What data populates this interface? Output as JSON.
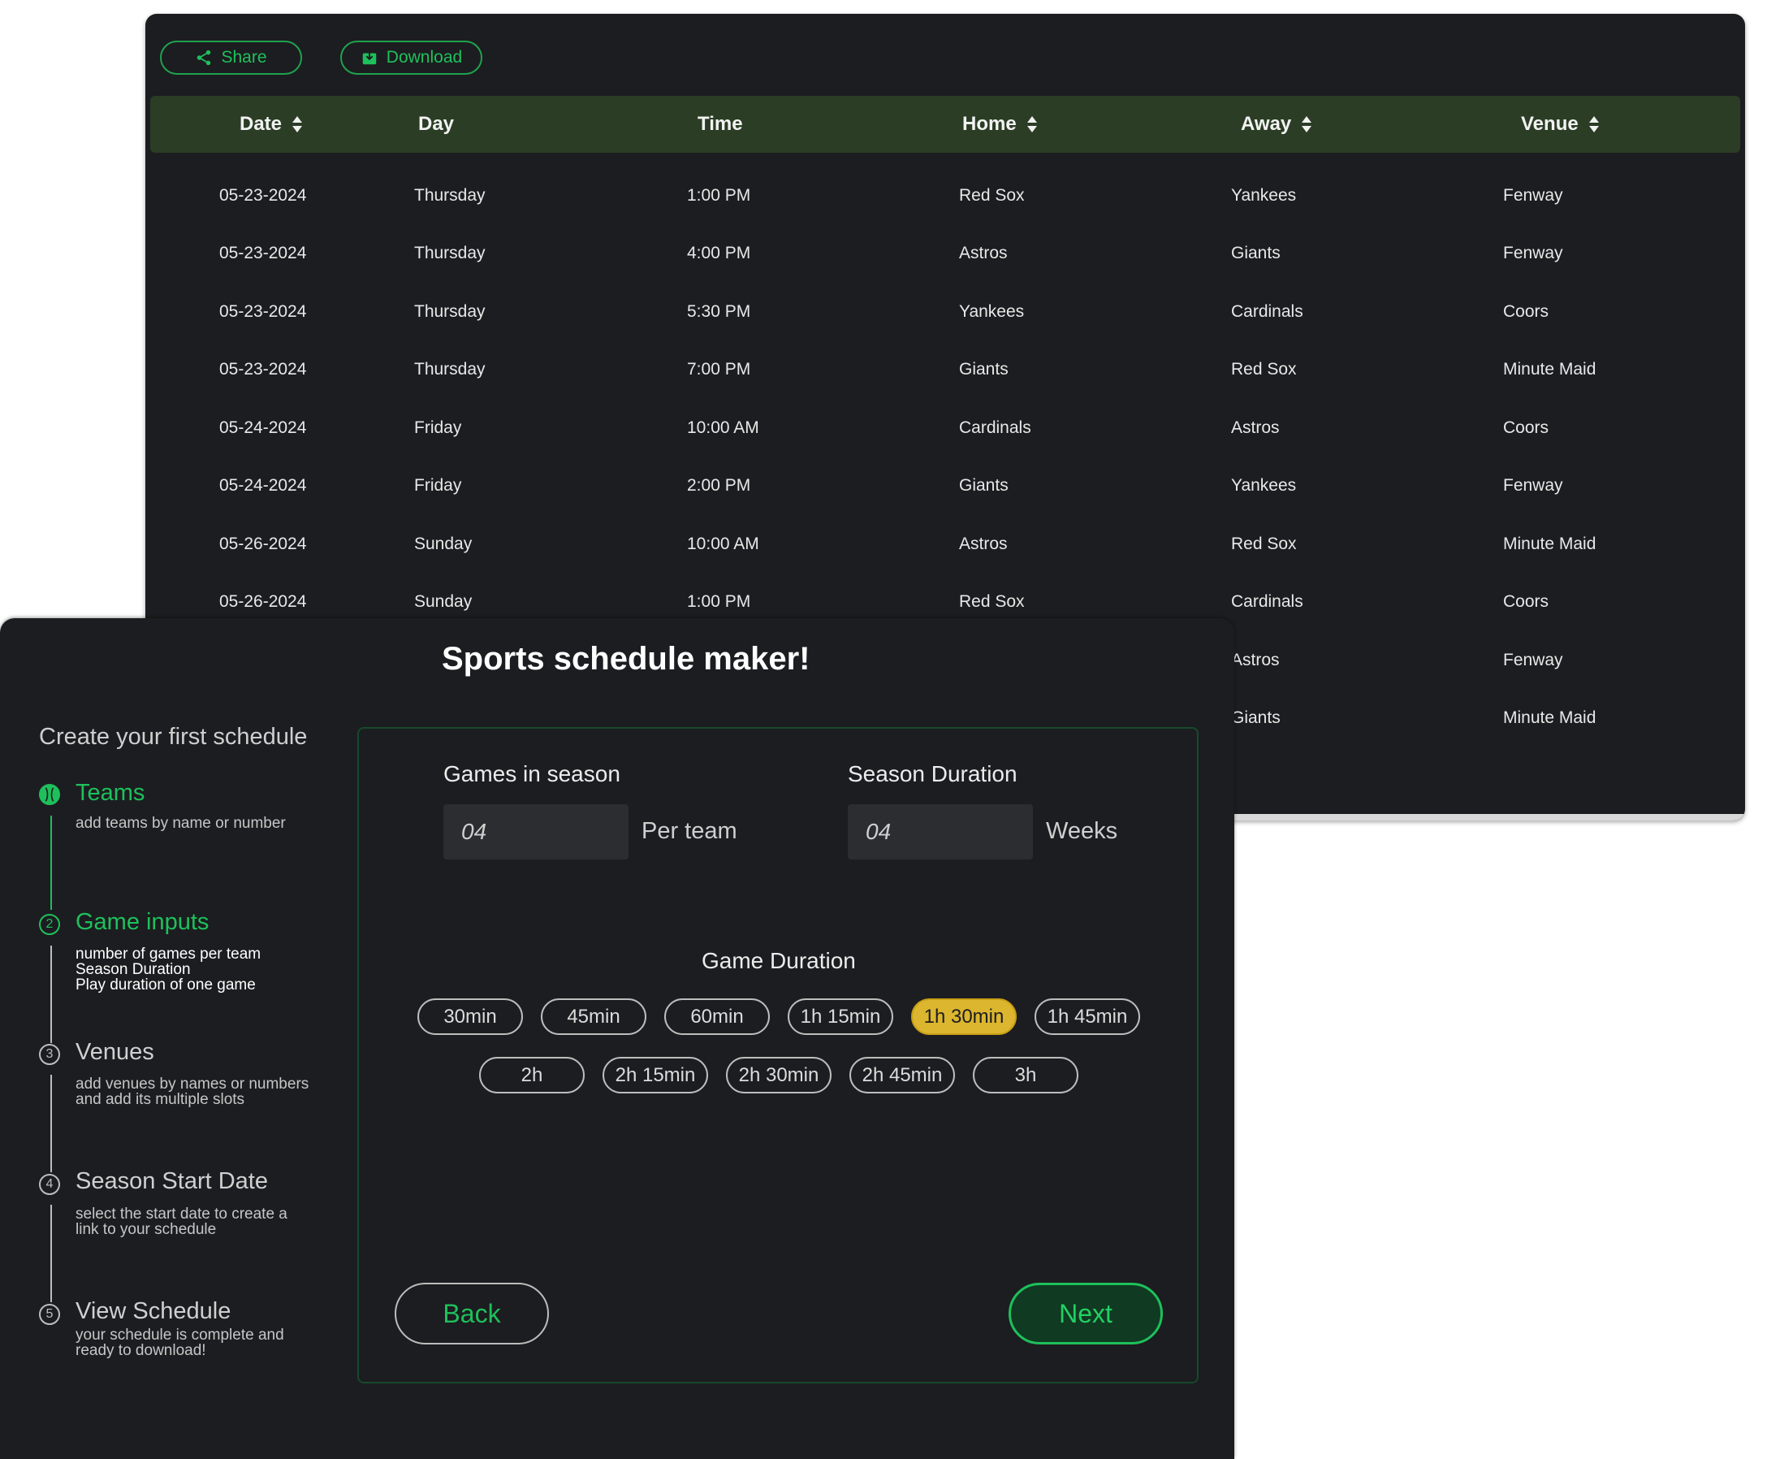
{
  "schedule": {
    "toolbar": {
      "share_label": "Share",
      "download_label": "Download"
    },
    "columns": [
      {
        "label": "Date",
        "sortable": true
      },
      {
        "label": "Day",
        "sortable": false
      },
      {
        "label": "Time",
        "sortable": false
      },
      {
        "label": "Home",
        "sortable": true
      },
      {
        "label": "Away",
        "sortable": true
      },
      {
        "label": "Venue",
        "sortable": true
      }
    ],
    "rows": [
      [
        "05-23-2024",
        "Thursday",
        "1:00 PM",
        "Red Sox",
        "Yankees",
        "Fenway"
      ],
      [
        "05-23-2024",
        "Thursday",
        "4:00 PM",
        "Astros",
        "Giants",
        "Fenway"
      ],
      [
        "05-23-2024",
        "Thursday",
        "5:30 PM",
        "Yankees",
        "Cardinals",
        "Coors"
      ],
      [
        "05-23-2024",
        "Thursday",
        "7:00 PM",
        "Giants",
        "Red Sox",
        "Minute Maid"
      ],
      [
        "05-24-2024",
        "Friday",
        "10:00 AM",
        "Cardinals",
        "Astros",
        "Coors"
      ],
      [
        "05-24-2024",
        "Friday",
        "2:00 PM",
        "Giants",
        "Yankees",
        "Fenway"
      ],
      [
        "05-26-2024",
        "Sunday",
        "10:00 AM",
        "Astros",
        "Red Sox",
        "Minute Maid"
      ],
      [
        "05-26-2024",
        "Sunday",
        "1:00 PM",
        "Red Sox",
        "Cardinals",
        "Coors"
      ],
      [
        "",
        "",
        "",
        "",
        "Astros",
        "Fenway"
      ],
      [
        "",
        "",
        "",
        "",
        "Giants",
        "Minute Maid"
      ]
    ]
  },
  "maker": {
    "title": "Sports schedule maker!",
    "sidebar_title": "Create your first schedule",
    "steps": [
      {
        "number": "1",
        "name": "Teams",
        "description": "add teams by name or number"
      },
      {
        "number": "2",
        "name": "Game inputs",
        "description": "number of games per team\nSeason Duration\nPlay duration of one game"
      },
      {
        "number": "3",
        "name": "Venues",
        "description": "add venues by names or numbers\nand add its multiple slots"
      },
      {
        "number": "4",
        "name": "Season Start Date",
        "description": "select the start date to create a\nlink to your schedule"
      },
      {
        "number": "5",
        "name": "View Schedule",
        "description": "your schedule is complete and\nready to download!"
      }
    ],
    "games_in_season": {
      "label": "Games in season",
      "value": "04",
      "unit": "Per team"
    },
    "season_duration": {
      "label": "Season Duration",
      "value": "04",
      "unit": "Weeks"
    },
    "game_duration": {
      "label": "Game Duration",
      "options": [
        "30min",
        "45min",
        "60min",
        "1h 15min",
        "1h 30min",
        "1h 45min",
        "2h",
        "2h 15min",
        "2h 30min",
        "2h 45min",
        "3h"
      ],
      "selected": "1h 30min"
    },
    "back_label": "Back",
    "next_label": "Next"
  },
  "colors": {
    "accent_green": "#1ec05c",
    "header_green": "#2b3d25",
    "selected_chip": "#dcb62e",
    "panel_bg": "#1c1d20"
  }
}
